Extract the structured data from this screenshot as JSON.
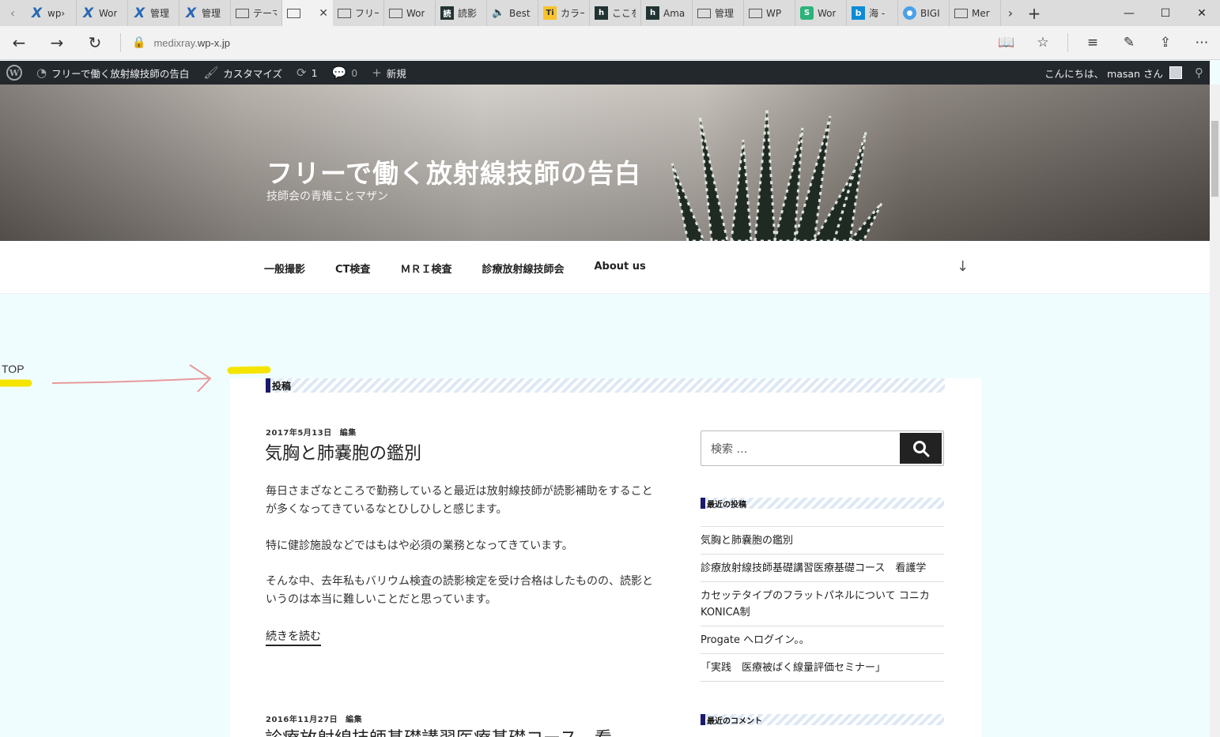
{
  "browser": {
    "tabs": [
      {
        "icon": "x-icon",
        "label": "wp›"
      },
      {
        "icon": "x-icon",
        "label": "Wor"
      },
      {
        "icon": "x-icon",
        "label": "管理"
      },
      {
        "icon": "x-icon",
        "label": "管理"
      },
      {
        "icon": "page-icon",
        "label": "テーマ"
      },
      {
        "icon": "page-icon",
        "label": ""
      },
      {
        "icon": "page-icon",
        "label": "フリー"
      },
      {
        "icon": "page-icon",
        "label": "Wor"
      },
      {
        "icon": "reader-icon",
        "label": "読影"
      },
      {
        "icon": "speaker-icon",
        "label": "Best"
      },
      {
        "icon": "ti-icon",
        "label": "カラー"
      },
      {
        "icon": "h-icon",
        "label": "ここを"
      },
      {
        "icon": "h-icon",
        "label": "Ama"
      },
      {
        "icon": "page-icon",
        "label": "管理"
      },
      {
        "icon": "page-icon",
        "label": "WP"
      },
      {
        "icon": "green-icon",
        "label": "Wor"
      },
      {
        "icon": "bing-icon",
        "label": "海 -"
      },
      {
        "icon": "globe-icon",
        "label": "BIGI"
      },
      {
        "icon": "page-icon",
        "label": "Mer"
      }
    ],
    "url_host": "medixray.",
    "url_domain": "wp-x.jp"
  },
  "adminbar": {
    "site_name": "フリーで働く放射線技師の告白",
    "customize": "カスタマイズ",
    "updates_count": "1",
    "comments_count": "0",
    "new_label": "新規",
    "greeting": "こんにちは、 masan さん"
  },
  "header": {
    "site_title": "フリーで働く放射線技師の告白",
    "site_description": "技師会の青雉ことマザン"
  },
  "nav": {
    "items": [
      "一般撮影",
      "CT検査",
      "ＭＲＩ検査",
      "診療放射線技師会",
      "About us"
    ]
  },
  "annotation": {
    "top_label": "TOP"
  },
  "content": {
    "section_title": "投稿",
    "post1": {
      "date": "2017年5月13日",
      "edit": "編集",
      "title": "気胸と肺嚢胞の鑑別",
      "paragraphs": [
        "毎日さまざなところで勤務していると最近は放射線技師が読影補助をすることが多くなってきているなとひしひしと感じます。",
        "特に健診施設などではもはや必須の業務となってきています。",
        "そんな中、去年私もバリウム検査の読影検定を受け合格はしたものの、読影というのは本当に難しいことだと思っています。"
      ],
      "read_more": "続きを読む"
    },
    "post2": {
      "date": "2016年11月27日",
      "edit": "編集",
      "title": "診療放射線技師基礎講習医療基礎コース　看"
    }
  },
  "sidebar": {
    "search_placeholder": "検索 …",
    "recent_title": "最近の投稿",
    "recent_posts": [
      "気胸と肺嚢胞の鑑別",
      "診療放射線技師基礎講習医療基礎コース　看護学",
      "カセッテタイプのフラットパネルについて コニカKONICA制",
      "Progate へログイン。。",
      "「実践　医療被ばく線量評価セミナー」"
    ],
    "comments_title": "最近のコメント"
  }
}
